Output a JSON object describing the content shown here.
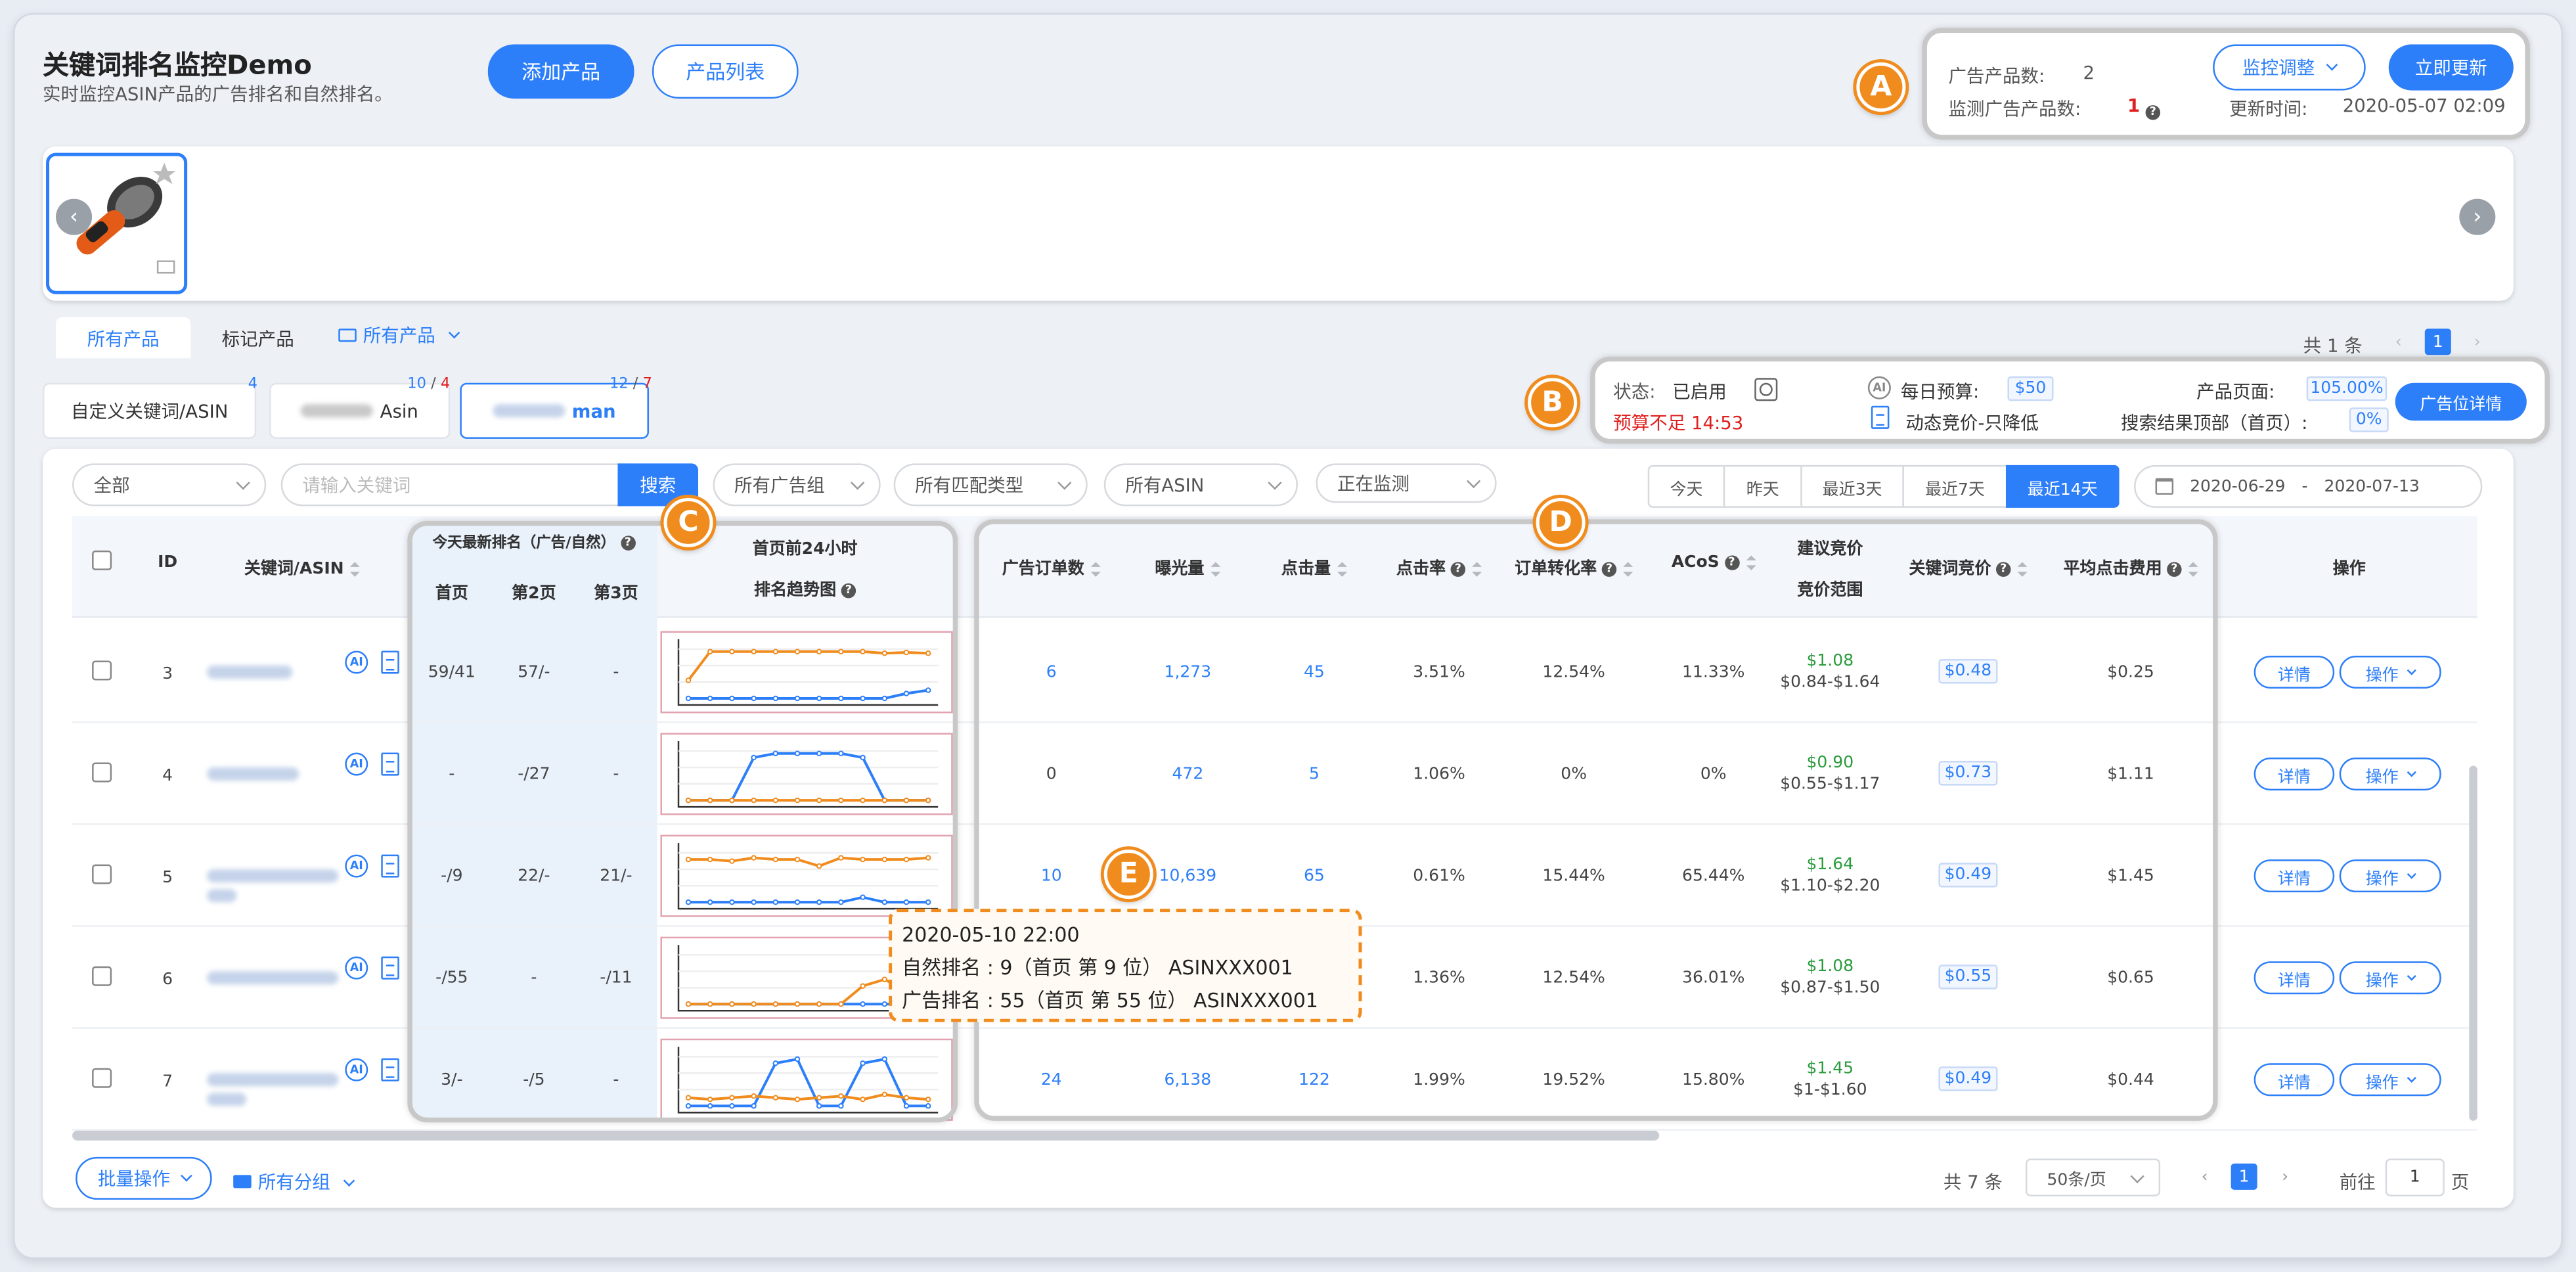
{
  "header": {
    "title": "关键词排名监控Demo",
    "subtitle": "实时监控ASIN产品的广告排名和自然排名。",
    "add_product": "添加产品",
    "product_list": "产品列表"
  },
  "panel_a": {
    "badge": "A",
    "ad_products_label": "广告产品数:",
    "ad_products_value": "2",
    "monitor_label": "监测广告产品数:",
    "monitor_value": "1",
    "monitor_adjust": "监控调整",
    "update_now": "立即更新",
    "update_time_label": "更新时间:",
    "update_time": "2020-05-07 02:09"
  },
  "filter_tabs": {
    "all": "所有产品",
    "marked": "标记产品",
    "group": "所有产品",
    "total": "共 1 条",
    "page": "1"
  },
  "kw_tabs": [
    {
      "label": "自定义关键词/ASIN",
      "count": "4"
    },
    {
      "label": "Asin",
      "count_a": "10",
      "count_b": "4"
    },
    {
      "label": "man",
      "count_a": "12",
      "count_b": "7"
    }
  ],
  "panel_b": {
    "badge": "B",
    "status_label": "状态:",
    "status_value": "已启用",
    "budget_warn": "预算不足 14:53",
    "daily_budget_label": "每日预算:",
    "daily_budget": "$50",
    "dynamic_bid": "动态竞价-只降低",
    "product_page_label": "产品页面:",
    "product_page": "105.00%",
    "search_top_label": "搜索结果顶部（首页）:",
    "search_top": "0%",
    "detail_btn": "广告位详情"
  },
  "toolbar": {
    "all": "全部",
    "keyword_placeholder": "请输入关键词",
    "search": "搜索",
    "ad_groups": "所有广告组",
    "match_types": "所有匹配类型",
    "asins": "所有ASIN",
    "monitoring": "正在监测",
    "ranges": [
      "今天",
      "昨天",
      "最近3天",
      "最近7天",
      "最近14天"
    ],
    "date_from": "2020-06-29",
    "date_sep": "-",
    "date_to": "2020-07-13"
  },
  "table": {
    "headers": {
      "id": "ID",
      "keyword": "关键词/ASIN",
      "rank_today": "今天最新排名（广告/自然）",
      "page1": "首页",
      "page2": "第2页",
      "page3": "第3页",
      "trend_top": "首页前24小时",
      "trend": "排名趋势图",
      "orders": "广告订单数",
      "impressions": "曝光量",
      "clicks": "点击量",
      "ctr": "点击率",
      "cvr": "订单转化率",
      "acos": "ACoS",
      "suggest_top": "建议竞价",
      "suggest_range": "竞价范围",
      "kw_bid": "关键词竞价",
      "cpc": "平均点击费用",
      "ops": "操作"
    },
    "detail_label": "详情",
    "op_label": "操作",
    "ai_label": "AI",
    "rows": [
      {
        "id": "3",
        "p1": "59/41",
        "p2": "57/-",
        "p3": "-",
        "orders": "6",
        "impressions": "1,273",
        "clicks": "45",
        "ctr": "3.51%",
        "cvr": "12.54%",
        "acos": "11.33%",
        "suggest": "$1.08",
        "range": "$0.84-$1.64",
        "bid": "$0.48",
        "cpc": "$0.25"
      },
      {
        "id": "4",
        "p1": "-",
        "p2": "-/27",
        "p3": "-",
        "orders": "0",
        "impressions": "472",
        "clicks": "5",
        "ctr": "1.06%",
        "cvr": "0%",
        "acos": "0%",
        "suggest": "$0.90",
        "range": "$0.55-$1.17",
        "bid": "$0.73",
        "cpc": "$1.11"
      },
      {
        "id": "5",
        "p1": "-/9",
        "p2": "22/-",
        "p3": "21/-",
        "orders": "10",
        "impressions": "10,639",
        "clicks": "65",
        "ctr": "0.61%",
        "cvr": "15.44%",
        "acos": "65.44%",
        "suggest": "$1.64",
        "range": "$1.10-$2.20",
        "bid": "$0.49",
        "cpc": "$1.45"
      },
      {
        "id": "6",
        "p1": "-/55",
        "p2": "-",
        "p3": "-/11",
        "orders": "",
        "impressions": "",
        "clicks": "",
        "ctr": "1.36%",
        "cvr": "12.54%",
        "acos": "36.01%",
        "suggest": "$1.08",
        "range": "$0.87-$1.50",
        "bid": "$0.55",
        "cpc": "$0.65"
      },
      {
        "id": "7",
        "p1": "3/-",
        "p2": "-/5",
        "p3": "-",
        "orders": "24",
        "impressions": "6,138",
        "clicks": "122",
        "ctr": "1.99%",
        "cvr": "19.52%",
        "acos": "15.80%",
        "suggest": "$1.45",
        "range": "$1-$1.60",
        "bid": "$0.49",
        "cpc": "$0.44"
      }
    ]
  },
  "badges": {
    "c": "C",
    "d": "D",
    "e": "E"
  },
  "tooltip": {
    "time": "2020-05-10 22:00",
    "natural": "自然排名 : 9（首页 第 9 位） ASINXXX001",
    "ad": "广告排名 : 55（首页 第 55 位） ASINXXX001"
  },
  "footer": {
    "bulk": "批量操作",
    "groups": "所有分组",
    "total": "共 7 条",
    "per_page": "50条/页",
    "page": "1",
    "goto": "前往",
    "goto_value": "1",
    "page_unit": "页"
  },
  "colors": {
    "accent": "#2d7ff9",
    "badge": "#f08c1e",
    "ad_line": "#f08c1e",
    "natural_line": "#2d7ff9"
  },
  "sparklines": [
    {
      "ad": [
        50,
        15,
        15,
        15,
        15,
        15,
        15,
        15,
        15,
        17,
        16,
        17
      ],
      "natural": [
        72,
        72,
        72,
        72,
        72,
        72,
        72,
        72,
        72,
        72,
        66,
        62
      ]
    },
    {
      "ad": [
        72,
        72,
        72,
        72,
        72,
        72,
        72,
        72,
        72,
        72,
        72,
        72
      ],
      "natural": [
        72,
        72,
        72,
        20,
        15,
        15,
        15,
        15,
        20,
        72,
        72,
        72
      ]
    },
    {
      "ad": [
        20,
        20,
        22,
        18,
        20,
        20,
        28,
        18,
        20,
        20,
        20,
        18
      ],
      "natural": [
        72,
        72,
        72,
        72,
        72,
        72,
        72,
        72,
        66,
        72,
        72,
        72
      ]
    },
    {
      "ad": [
        72,
        72,
        72,
        72,
        72,
        72,
        72,
        72,
        50,
        42,
        56,
        72
      ],
      "natural": [
        72,
        72,
        72,
        72,
        72,
        72,
        72,
        72,
        72,
        72,
        72,
        72
      ]
    },
    {
      "ad": [
        62,
        64,
        62,
        60,
        62,
        64,
        62,
        60,
        64,
        58,
        62,
        64
      ],
      "natural": [
        72,
        72,
        72,
        72,
        20,
        15,
        72,
        72,
        20,
        15,
        72,
        72
      ]
    }
  ]
}
